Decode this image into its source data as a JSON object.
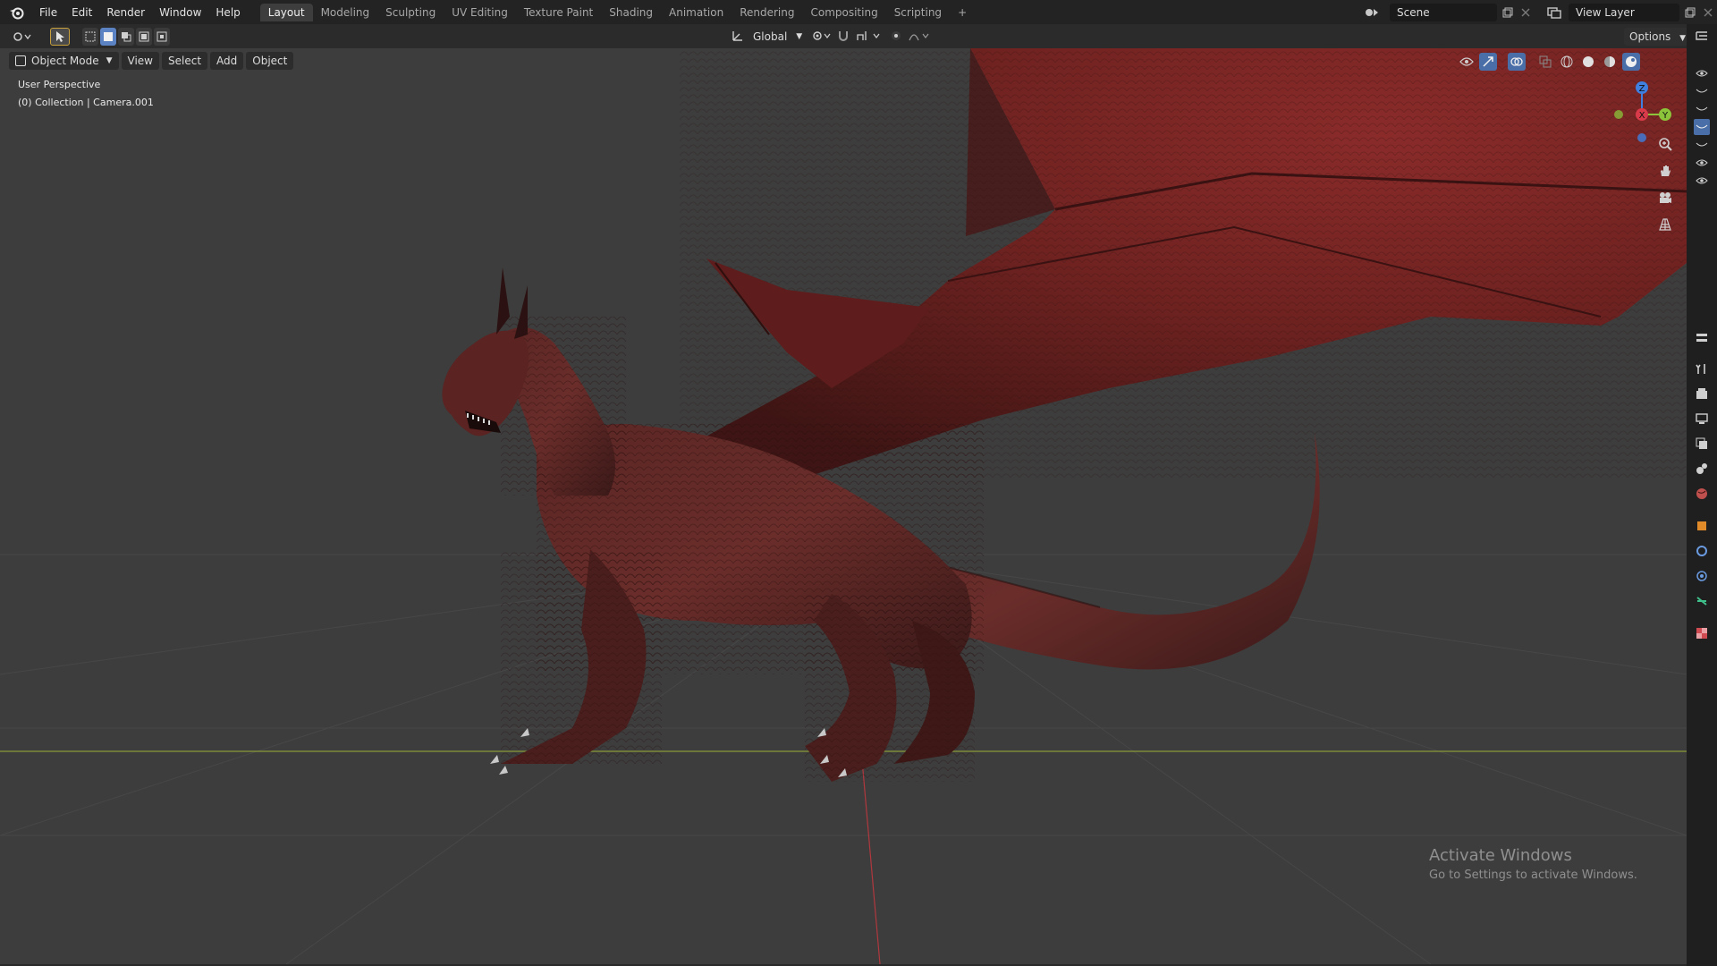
{
  "topbar": {
    "menu": [
      "File",
      "Edit",
      "Render",
      "Window",
      "Help"
    ],
    "workspaces": [
      "Layout",
      "Modeling",
      "Sculpting",
      "UV Editing",
      "Texture Paint",
      "Shading",
      "Animation",
      "Rendering",
      "Compositing",
      "Scripting"
    ],
    "active_workspace": "Layout",
    "scene_name": "Scene",
    "view_layer_name": "View Layer"
  },
  "toolbar": {
    "transform_orientation": "Global",
    "options_label": "Options"
  },
  "viewport": {
    "mode": "Object Mode",
    "menus": [
      "View",
      "Select",
      "Add",
      "Object"
    ],
    "perspective_label": "User Perspective",
    "collection_label": "(0) Collection | Camera.001",
    "gizmo_axes": {
      "z": "Z",
      "x": "X",
      "y": "Y"
    },
    "colors": {
      "background": "#3d3d3d",
      "x_axis": "#d83a4a",
      "y_axis": "#8bc43a",
      "z_axis": "#3e7fe0",
      "dragon": "#7a2a26"
    }
  },
  "watermark": {
    "title": "Activate Windows",
    "subtitle": "Go to Settings to activate Windows."
  },
  "icons": [
    "blender-logo-icon",
    "editor-type-icon",
    "select-arrow-icon",
    "select-box-icon",
    "scene-icon",
    "view-layer-icon",
    "copy-icon",
    "close-icon",
    "pivot-icon",
    "snap-icon",
    "proportional-edit-icon",
    "visibility-icon",
    "gizmo-icon",
    "overlay-icon",
    "xray-icon",
    "wireframe-shading-icon",
    "solid-shading-icon",
    "material-shading-icon",
    "rendered-shading-icon",
    "zoom-icon",
    "hand-icon",
    "camera-icon",
    "grid-icon",
    "outliner-icon",
    "properties-icon",
    "tool-icon",
    "render-icon",
    "output-icon",
    "view-layer-props-icon",
    "scene-props-icon",
    "world-icon",
    "object-icon",
    "modifier-icon",
    "physics-icon",
    "constraint-icon",
    "data-icon",
    "texture-icon"
  ]
}
